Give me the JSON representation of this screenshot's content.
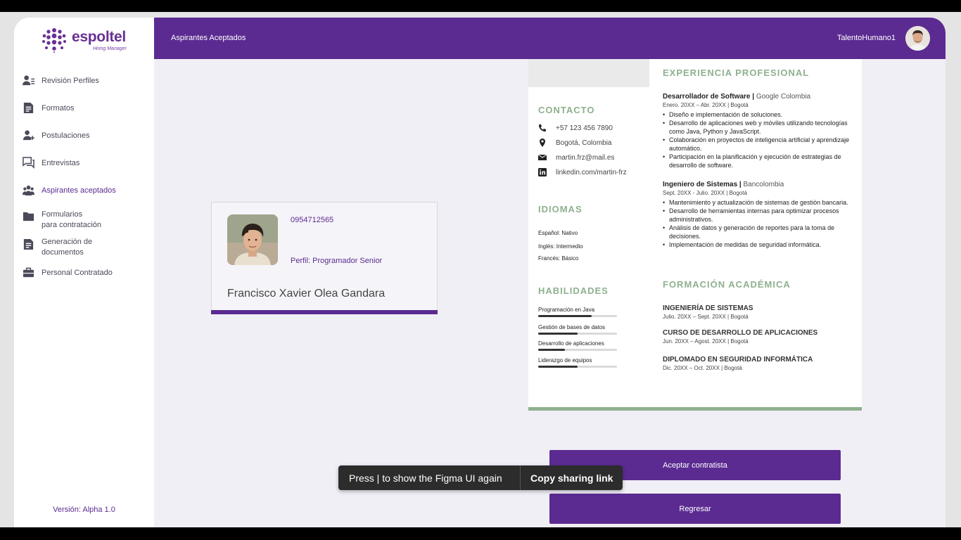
{
  "app": {
    "logo_text": "espoltel",
    "logo_sub": "Hiring Manager",
    "version": "Versión: Alpha 1.0"
  },
  "sidebar": {
    "items": [
      {
        "label": "Revisión Perfiles",
        "icon": "user-list-icon",
        "active": false
      },
      {
        "label": "Formatos",
        "icon": "document-icon",
        "active": false
      },
      {
        "label": "Postulaciones",
        "icon": "user-add-icon",
        "active": false
      },
      {
        "label": "Entrevistas",
        "icon": "chat-icon",
        "active": false
      },
      {
        "label": "Aspirantes aceptados",
        "icon": "team-icon",
        "active": true
      },
      {
        "label": "Formularios\npara contratación",
        "icon": "folder-icon",
        "active": false
      },
      {
        "label": "Generación de\ndocumentos",
        "icon": "document-icon",
        "active": false
      },
      {
        "label": "Personal Contratado",
        "icon": "briefcase-icon",
        "active": false
      }
    ]
  },
  "header": {
    "title": "Aspirantes Aceptados",
    "user": "TalentoHumano1"
  },
  "candidate": {
    "id": "0954712565",
    "profile": "Perfil: Programador Senior",
    "name": "Francisco Xavier Olea Gandara"
  },
  "cv": {
    "contact_heading": "CONTACTO",
    "contact": [
      {
        "icon": "phone-icon",
        "text": "+57 123 456 7890"
      },
      {
        "icon": "location-icon",
        "text": "Bogotá, Colombia"
      },
      {
        "icon": "mail-icon",
        "text": "martin.frz@mail.es"
      },
      {
        "icon": "linkedin-icon",
        "text": "linkedin.com/martin-frz"
      }
    ],
    "languages_heading": "IDIOMAS",
    "languages": [
      "Español: Nativo",
      "Inglés: Intermedio",
      "Francés: Básico"
    ],
    "skills_heading": "HABILIDADES",
    "skills": [
      {
        "label": "Programación en Java",
        "level": 0.68
      },
      {
        "label": "Gestión de bases de datos",
        "level": 0.5
      },
      {
        "label": "Desarrollo de aplicaciones",
        "level": 0.34
      },
      {
        "label": "Liderazgo de equipos",
        "level": 0.5
      }
    ],
    "experience_heading": "EXPERIENCIA PROFESIONAL",
    "jobs": [
      {
        "title": "Desarrollador de Software",
        "company": "Google Colombia",
        "meta": "Enero. 20XX – Abr. 20XX | Bogotá",
        "bullets": [
          "Diseño e implementación de soluciones.",
          "Desarrollo de aplicaciones web y móviles utilizando tecnologías como Java, Python y JavaScript.",
          "Colaboración en proyectos de inteligencia artificial y aprendizaje automático.",
          "Participación en la planificación y ejecución de estrategias de desarrollo de software."
        ]
      },
      {
        "title": "Ingeniero de Sistemas",
        "company": "Bancolombia",
        "meta": "Sept. 20XX - Julio. 20XX | Bogotá",
        "bullets": [
          "Mantenimiento y actualización de sistemas de gestión bancaria.",
          "Desarrollo de herramientas internas para optimizar procesos administrativos.",
          "Análisis de datos y generación de reportes para la toma de decisiones.",
          "Implementación de medidas de seguridad informática."
        ]
      }
    ],
    "education_heading": "FORMACIÓN ACADÉMICA",
    "education": [
      {
        "title": "INGENIERÍA DE SISTEMAS",
        "meta": "Julio. 20XX – Sept. 20XX | Bogotá"
      },
      {
        "title": "CURSO DE DESARROLLO DE APLICACIONES",
        "meta": "Jun. 20XX – Agost. 20XX | Bogotá"
      },
      {
        "title": "DIPLOMADO EN SEGURIDAD INFORMÁTICA",
        "meta": "Dic. 20XX – Oct. 20XX | Bogotá"
      }
    ]
  },
  "actions": {
    "accept": "Aceptar contratista",
    "back": "Regresar"
  },
  "toast": {
    "message": "Press | to show the Figma UI again",
    "link": "Copy sharing link"
  },
  "colors": {
    "brand": "#5b2b91",
    "cv_accent": "#8fb08f"
  }
}
